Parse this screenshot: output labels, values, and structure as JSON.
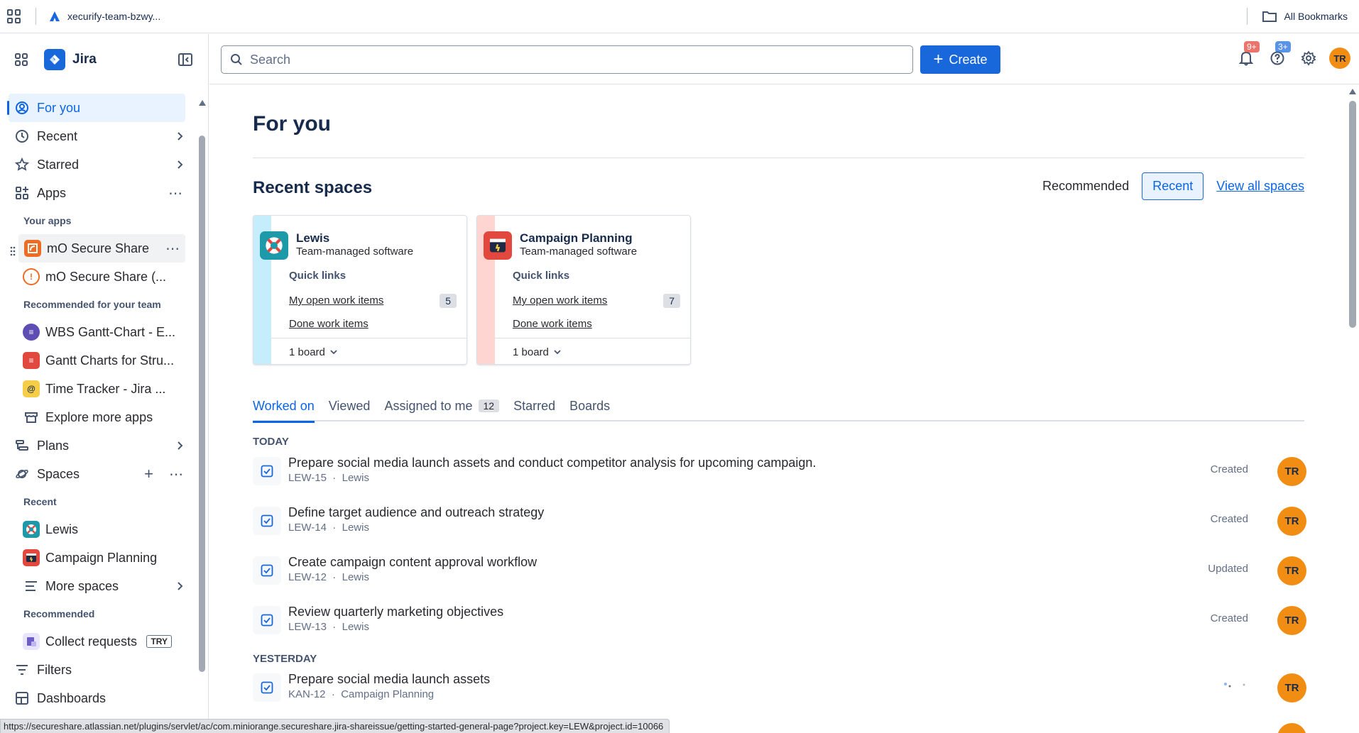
{
  "browser": {
    "tab_title": "xecurify-team-bzwy...",
    "bookmarks_label": "All Bookmarks"
  },
  "sidebar": {
    "product_name": "Jira",
    "nav": {
      "for_you": "For you",
      "recent": "Recent",
      "starred": "Starred",
      "apps": "Apps"
    },
    "your_apps_label": "Your apps",
    "your_apps": [
      {
        "label": "mO Secure Share"
      },
      {
        "label": "mO Secure Share (..."
      }
    ],
    "recommended_team_label": "Recommended for your team",
    "recommended_apps": [
      {
        "label": "WBS Gantt-Chart - E..."
      },
      {
        "label": "Gantt Charts for Stru..."
      },
      {
        "label": "Time Tracker - Jira ..."
      }
    ],
    "explore_apps": "Explore more apps",
    "plans": "Plans",
    "spaces": "Spaces",
    "spaces_recent_label": "Recent",
    "recent_spaces": [
      {
        "label": "Lewis"
      },
      {
        "label": "Campaign Planning"
      }
    ],
    "more_spaces": "More spaces",
    "recommended_label": "Recommended",
    "collect_requests": "Collect requests",
    "try_badge": "TRY",
    "filters": "Filters",
    "dashboards": "Dashboards"
  },
  "topbar": {
    "search_placeholder": "Search",
    "create_label": "Create",
    "notifications_badge": "9+",
    "help_badge": "3+",
    "avatar_initials": "TR"
  },
  "main": {
    "title": "For you",
    "recent_spaces_title": "Recent spaces",
    "toggle_recommended": "Recommended",
    "toggle_recent": "Recent",
    "view_all": "View all spaces",
    "spaces": [
      {
        "name": "Lewis",
        "type": "Team-managed software",
        "quick_links": "Quick links",
        "open_items": "My open work items",
        "open_count": "5",
        "done_items": "Done work items",
        "boards": "1 board"
      },
      {
        "name": "Campaign Planning",
        "type": "Team-managed software",
        "quick_links": "Quick links",
        "open_items": "My open work items",
        "open_count": "7",
        "done_items": "Done work items",
        "boards": "1 board"
      }
    ],
    "tabs": {
      "worked_on": "Worked on",
      "viewed": "Viewed",
      "assigned": "Assigned to me",
      "assigned_count": "12",
      "starred": "Starred",
      "boards": "Boards"
    },
    "today_label": "TODAY",
    "yesterday_label": "YESTERDAY",
    "items": [
      {
        "title": "Prepare social media launch assets and conduct competitor analysis for upcoming campaign.",
        "key": "LEW-15",
        "space": "Lewis",
        "action": "Created",
        "avatar": "TR"
      },
      {
        "title": "Define target audience and outreach strategy",
        "key": "LEW-14",
        "space": "Lewis",
        "action": "Created",
        "avatar": "TR"
      },
      {
        "title": "Create campaign content approval workflow",
        "key": "LEW-12",
        "space": "Lewis",
        "action": "Updated",
        "avatar": "TR"
      },
      {
        "title": "Review quarterly marketing objectives",
        "key": "LEW-13",
        "space": "Lewis",
        "action": "Created",
        "avatar": "TR"
      },
      {
        "title": "Prepare social media launch assets",
        "key": "KAN-12",
        "space": "Campaign Planning",
        "action": "",
        "avatar": "TR"
      }
    ],
    "meta_separator": "·"
  },
  "status_url": "https://secureshare.atlassian.net/plugins/servlet/ac/com.miniorange.secureshare.jira-shareissue/getting-started-general-page?project.key=LEW&project.id=10066",
  "colors": {
    "accent": "#1868db",
    "lewis_stripe": "#c6edfb",
    "campaign_stripe": "#ffd5d2",
    "avatar": "#f18d13"
  }
}
